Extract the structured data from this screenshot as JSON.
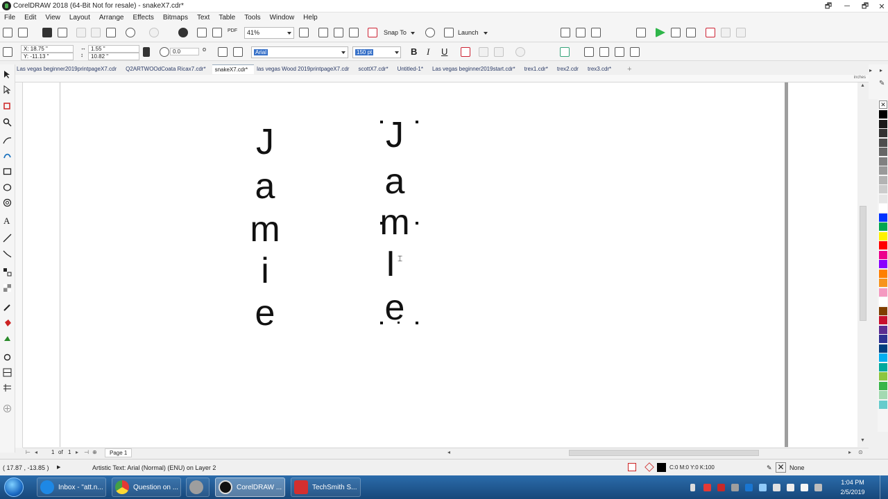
{
  "window": {
    "title": "CorelDRAW 2018 (64-Bit Not for resale) - snakeX7.cdr*",
    "controls": [
      "🗗",
      "─",
      "🗗",
      "✕"
    ]
  },
  "menu": [
    "File",
    "Edit",
    "View",
    "Layout",
    "Arrange",
    "Effects",
    "Bitmaps",
    "Text",
    "Table",
    "Tools",
    "Window",
    "Help"
  ],
  "toolbar": {
    "zoom": "41%",
    "snap_to": "Snap To",
    "launch": "Launch",
    "pdf_label": "PDF"
  },
  "property_bar": {
    "x": "X: 18.75 \"",
    "y": "Y: -11.13 \"",
    "w": "1.55 \"",
    "h": "10.82 \"",
    "rotation": "0.0",
    "font": "Arial",
    "size": "150 pt",
    "bold": "B",
    "italic": "I",
    "underline": "U"
  },
  "tabs": [
    {
      "label": "Las vegas beginner2019printpageX7.cdr",
      "active": false
    },
    {
      "label": "Q2ARTWOOdCoata Ricax7.cdr*",
      "active": false
    },
    {
      "label": "snakeX7.cdr*",
      "active": true
    },
    {
      "label": "las vegas Wood 2019printpageX7.cdr",
      "active": false
    },
    {
      "label": "scottX7.cdr*",
      "active": false
    },
    {
      "label": "Untitled-1*",
      "active": false
    },
    {
      "label": "Las vegas beginner2019start.cdr*",
      "active": false
    },
    {
      "label": "trex1.cdr*",
      "active": false
    },
    {
      "label": "trex2.cdr",
      "active": false
    },
    {
      "label": "trex3.cdr*",
      "active": false
    }
  ],
  "tab_add": "+",
  "ruler": {
    "units": "inches"
  },
  "canvas": {
    "column_left": [
      "J",
      "a",
      "m",
      "i",
      "e"
    ],
    "column_right": [
      "J",
      "a",
      "m",
      "I",
      "e"
    ]
  },
  "page_nav": {
    "current": "1",
    "of": "of",
    "total": "1",
    "page_tab": "Page 1"
  },
  "status": {
    "coords": "( 17.87 , -13.85 )",
    "object_info": "Artistic Text: Arial (Normal) (ENU) on Layer 2",
    "fill_info": "C:0 M:0 Y:0 K:100",
    "outline": "None"
  },
  "palette_colors": [
    "#000000",
    "#1a1a1a",
    "#333333",
    "#4d4d4d",
    "#666666",
    "#808080",
    "#999999",
    "#b3b3b3",
    "#cccccc",
    "#e6e6e6",
    "#ffffff",
    "#0033ff",
    "#00a650",
    "#fff200",
    "#ff0000",
    "#ec008c",
    "#8b00ff",
    "#ff7f00",
    "#f7941d",
    "#f49ac1",
    "#ffffff",
    "#7f3f00",
    "#c8102e",
    "#5c2d91",
    "#2e3192",
    "#003f7f",
    "#00aeef",
    "#00a99d",
    "#8dc63f",
    "#39b54a",
    "#a3d9b1",
    "#66cccc"
  ],
  "taskbar": {
    "items": [
      {
        "label": "Inbox - \"att.n...",
        "color": "#1e88e5",
        "active": false
      },
      {
        "label": "Question on ...",
        "color": "#e53935",
        "active": false
      },
      {
        "label": "",
        "color": "#9e9e9e",
        "active": false
      },
      {
        "label": "CorelDRAW ...",
        "color": "#111111",
        "active": true
      },
      {
        "label": "TechSmith S...",
        "color": "#d32f2f",
        "active": false
      }
    ],
    "time": "1:04 PM",
    "date": "2/5/2019"
  }
}
